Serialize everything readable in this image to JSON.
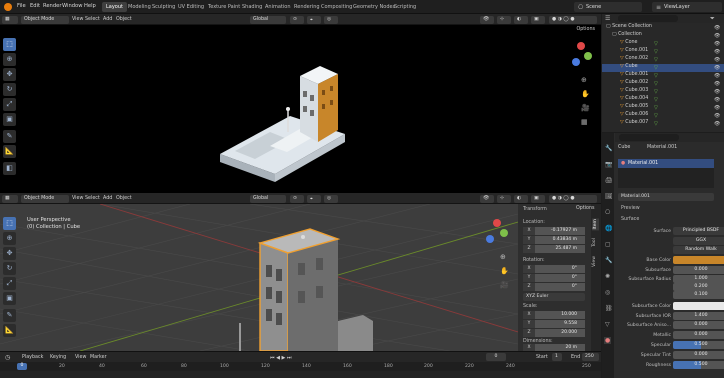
{
  "menu": [
    "File",
    "Edit",
    "Render",
    "Window",
    "Help"
  ],
  "workspaces": [
    "Layout",
    "Modeling",
    "Sculpting",
    "UV Editing",
    "Texture Paint",
    "Shading",
    "Animation",
    "Rendering",
    "Compositing",
    "Geometry Nodes",
    "Scripting"
  ],
  "scene": {
    "name": "Scene",
    "view_layer": "ViewLayer"
  },
  "top_view": {
    "mode": "Object Mode",
    "menus": [
      "View",
      "Select",
      "Add",
      "Object"
    ],
    "orientation": "Global",
    "options": "Options"
  },
  "bottom_view": {
    "mode": "Object Mode",
    "menus": [
      "View",
      "Select",
      "Add",
      "Object"
    ],
    "orientation": "Global",
    "options": "Options",
    "perspective": "User Perspective",
    "collection_info": "(0) Collection | Cube",
    "tabs": [
      "Item",
      "Tool",
      "View"
    ]
  },
  "transform": {
    "title": "Transform",
    "location_label": "Location:",
    "location": [
      {
        "axis": "X",
        "value": "-0.17927 m"
      },
      {
        "axis": "Y",
        "value": "0.43834 m"
      },
      {
        "axis": "Z",
        "value": "25.487 m"
      }
    ],
    "rotation_label": "Rotation:",
    "rotation": [
      {
        "axis": "X",
        "value": "0°"
      },
      {
        "axis": "Y",
        "value": "0°"
      },
      {
        "axis": "Z",
        "value": "0°"
      }
    ],
    "rotation_mode": "XYZ Euler",
    "scale_label": "Scale:",
    "scale": [
      {
        "axis": "X",
        "value": "10.000"
      },
      {
        "axis": "Y",
        "value": "9.558"
      },
      {
        "axis": "Z",
        "value": "20.000"
      }
    ],
    "dimensions_label": "Dimensions:",
    "dimensions": [
      {
        "axis": "X",
        "value": "20 m"
      }
    ]
  },
  "outliner": {
    "root": "Scene Collection",
    "collection": "Collection",
    "items": [
      "Cone",
      "Cone.001",
      "Cone.002",
      "Cube",
      "Cube.001",
      "Cube.002",
      "Cube.003",
      "Cube.004",
      "Cube.005",
      "Cube.006",
      "Cube.007"
    ],
    "selected": "Cube"
  },
  "properties": {
    "object": "Cube",
    "material_slot_name": "Material.001",
    "slot_item": "Material.001",
    "material_name": "Material.001",
    "preview_label": "Preview",
    "surface_section": "Surface",
    "rows": [
      {
        "label": "Surface",
        "value": "Principled BSDF"
      },
      {
        "label": "",
        "value": "GGX"
      },
      {
        "label": "",
        "value": "Random Walk"
      },
      {
        "label": "Base Color",
        "value": ""
      },
      {
        "label": "Subsurface",
        "value": "0.000"
      },
      {
        "label": "Subsurface Radius",
        "value": "1.000"
      },
      {
        "label": "",
        "value": "0.200"
      },
      {
        "label": "",
        "value": "0.100"
      },
      {
        "label": "Subsurface Color",
        "value": ""
      },
      {
        "label": "Subsurface IOR",
        "value": "1.400"
      },
      {
        "label": "Subsurface Aniso...",
        "value": "0.000"
      },
      {
        "label": "Metallic",
        "value": "0.000"
      },
      {
        "label": "Specular",
        "value": "0.500"
      },
      {
        "label": "Specular Tint",
        "value": "0.000"
      },
      {
        "label": "Roughness",
        "value": "0.500"
      }
    ],
    "base_color": "#c8862a",
    "subsurface_color": "#e8e8e8"
  },
  "timeline": {
    "menus": [
      "Playback",
      "Keying",
      "View",
      "Marker"
    ],
    "current_frame": "0",
    "start_label": "Start",
    "start": "1",
    "end_label": "End",
    "end": "250",
    "ticks": [
      "0",
      "20",
      "40",
      "60",
      "80",
      "100",
      "120",
      "140",
      "160",
      "180",
      "200",
      "220",
      "240",
      "250"
    ]
  },
  "colors": {
    "accent": "#4772b3",
    "selected_outline": "#f0a030",
    "header": "#262626",
    "panel": "#2b2b2b"
  }
}
